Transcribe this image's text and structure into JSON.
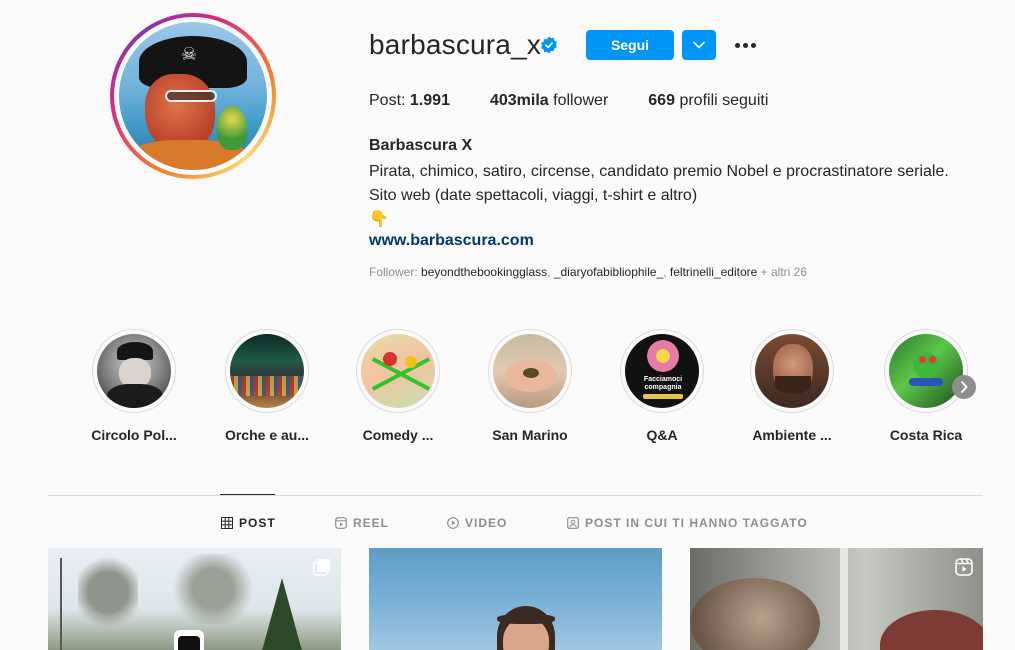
{
  "profile": {
    "username": "barbascura_x",
    "verified": true,
    "follow_label": "Segui",
    "stats": [
      {
        "label": "Post:",
        "value": "1.991",
        "order": "label-first"
      },
      {
        "label": "follower",
        "value": "403mila",
        "order": "value-first"
      },
      {
        "label": "profili seguiti",
        "value": "669",
        "order": "value-first"
      }
    ],
    "full_name": "Barbascura X",
    "bio_lines": [
      "Pirata, chimico, satiro, circense, candidato premio Nobel e procrastinatore seriale.",
      "Sito web (date spettacoli, viaggi, t-shirt e altro)",
      "👇"
    ],
    "website": "www.barbascura.com",
    "followed_by": {
      "prefix": "Follower:",
      "accounts": [
        "beyondthebookingglass",
        "_diaryofabibliophile_",
        "feltrinelli_editore"
      ],
      "suffix": "+ altri 26"
    }
  },
  "highlights": [
    {
      "label": "Circolo Pol..."
    },
    {
      "label": "Orche e au..."
    },
    {
      "label": "Comedy ..."
    },
    {
      "label": "San Marino"
    },
    {
      "label": "Q&A"
    },
    {
      "label": "Ambiente ..."
    },
    {
      "label": "Costa Rica"
    }
  ],
  "highlight_text": {
    "qa_cover": "Facciamoci compagnia"
  },
  "tabs": [
    {
      "label": "POST",
      "icon": "grid-icon",
      "active": true
    },
    {
      "label": "REEL",
      "icon": "reel-icon",
      "active": false
    },
    {
      "label": "VIDEO",
      "icon": "play-icon",
      "active": false
    },
    {
      "label": "POST IN CUI TI HANNO TAGGATO",
      "icon": "tagged-icon",
      "active": false
    }
  ],
  "posts": [
    {
      "type": "carousel",
      "icon": "carousel-icon"
    },
    {
      "type": "image",
      "icon": ""
    },
    {
      "type": "reel",
      "icon": "reel-icon"
    }
  ],
  "colors": {
    "accent": "#0095f6",
    "link": "#00376b",
    "muted": "#8e8e8e",
    "text": "#262626",
    "background": "#fafafa"
  }
}
